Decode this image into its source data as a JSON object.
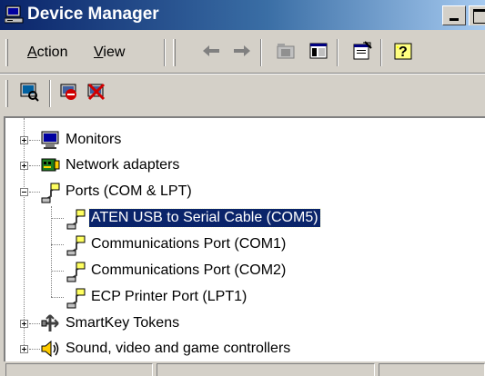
{
  "window": {
    "title": "Device Manager",
    "app_icon": "computer-icon",
    "controls": [
      "minimize-icon",
      "maximize-icon"
    ]
  },
  "menu": {
    "items": [
      {
        "label": "Action",
        "accelerator": "A"
      },
      {
        "label": "View",
        "accelerator": "V"
      }
    ]
  },
  "toolbar": {
    "buttons": [
      "back-arrow-icon",
      "forward-arrow-icon",
      "up-folder-icon",
      "show-hide-tree-icon",
      "properties-icon",
      "help-icon"
    ]
  },
  "toolbar2": {
    "buttons": [
      "scan-hardware-icon",
      "disable-device-icon",
      "uninstall-device-icon"
    ]
  },
  "tree": {
    "items": [
      {
        "label": "Monitors",
        "icon": "monitor-icon",
        "expander": "+"
      },
      {
        "label": "Network adapters",
        "icon": "network-adapter-icon",
        "expander": "+"
      },
      {
        "label": "Ports (COM & LPT)",
        "icon": "port-plug-icon",
        "expander": "-"
      },
      {
        "label": "ATEN USB to Serial Cable (COM5)",
        "icon": "port-plug-icon",
        "selected": true
      },
      {
        "label": "Communications Port (COM1)",
        "icon": "port-plug-icon"
      },
      {
        "label": "Communications Port (COM2)",
        "icon": "port-plug-icon"
      },
      {
        "label": "ECP Printer Port (LPT1)",
        "icon": "port-plug-icon"
      },
      {
        "label": "SmartKey Tokens",
        "icon": "smartkey-icon",
        "expander": "+"
      },
      {
        "label": "Sound, video and game controllers",
        "icon": "speaker-icon",
        "expander": "+"
      }
    ]
  },
  "colors": {
    "selection": "#0a246a",
    "face": "#d4d0c8",
    "title_start": "#0a246a",
    "title_end": "#a6caf0"
  }
}
